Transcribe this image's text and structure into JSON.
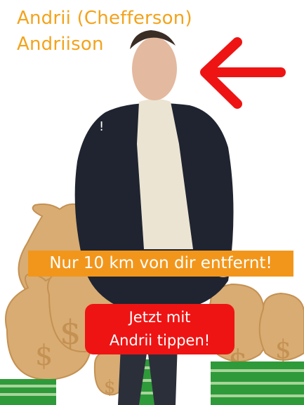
{
  "header": {
    "title_line1": "Andrii (Chefferson)",
    "title_line2": "Andriison"
  },
  "badge": {
    "text": "Nur 10 km von dir entfernt!"
  },
  "cta": {
    "line1": "Jetzt mit",
    "line2": "Andrii tippen!"
  },
  "colors": {
    "title": "#f2a31c",
    "badge_bg": "#f2961b",
    "cta_bg": "#ee1414",
    "arrow": "#ee1414",
    "money_bag": "#d8ac73",
    "cash": "#2f9a3a"
  },
  "icons": [
    "red-arrow-left-icon",
    "money-bag-icon",
    "cash-stack-icon",
    "person-photo"
  ]
}
